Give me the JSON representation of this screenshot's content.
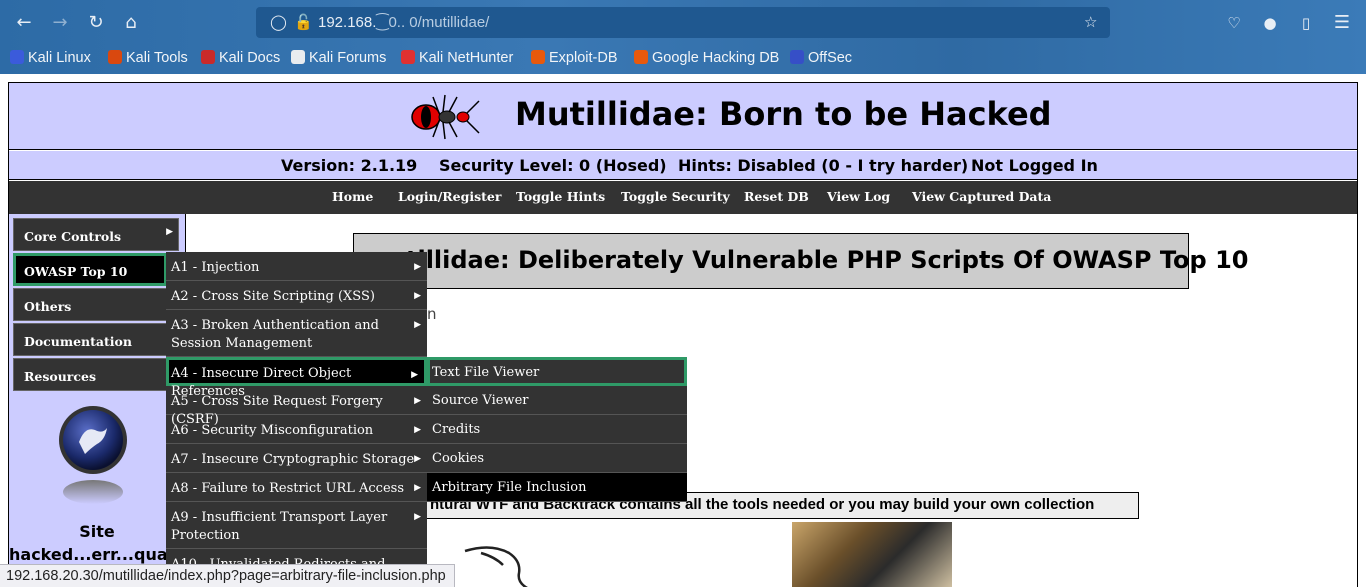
{
  "browser": {
    "url_main": "192.168.",
    "url_blur": "⁐0.. 0",
    "url_path": "/mutillidae/",
    "bookmarks": [
      {
        "label": "Kali Linux",
        "color": "#3b5bdb"
      },
      {
        "label": "Kali Tools",
        "color": "#d9480f"
      },
      {
        "label": "Kali Docs",
        "color": "#c92a2a"
      },
      {
        "label": "Kali Forums",
        "color": "#e9ecef"
      },
      {
        "label": "Kali NetHunter",
        "color": "#e03131"
      },
      {
        "label": "Exploit-DB",
        "color": "#e8590c"
      },
      {
        "label": "Google Hacking DB",
        "color": "#e8590c"
      },
      {
        "label": "OffSec",
        "color": "#364fc7"
      }
    ],
    "status_link": "192.168.20.30/mutillidae/index.php?page=arbitrary-file-inclusion.php"
  },
  "header": {
    "title": "Mutillidae: Born to be Hacked",
    "version": "Version: 2.1.19",
    "security": "Security Level: 0 (Hosed)",
    "hints": "Hints: Disabled (0 - I try harder)",
    "login": "Not Logged In"
  },
  "topnav": [
    "Home",
    "Login/Register",
    "Toggle Hints",
    "Toggle Security",
    "Reset DB",
    "View Log",
    "View Captured Data"
  ],
  "left_menu": [
    "Core Controls",
    "OWASP Top 10",
    "Others",
    "Documentation",
    "Resources"
  ],
  "left_text": {
    "line1": "Site",
    "line2": "hacked...err...qualit"
  },
  "owasp_menu": [
    "A1 - Injection",
    "A2 - Cross Site Scripting (XSS)",
    "A3 - Broken Authentication and Session Management",
    "A4 - Insecure Direct Object References",
    "A5 - Cross Site Request Forgery (CSRF)",
    "A6 - Security Misconfiguration",
    "A7 - Insecure Cryptographic Storage",
    "A8 - Failure to Restrict URL Access",
    "A9 - Insufficient Transport Layer Protection",
    "A10 - Unvalidated Redirects and"
  ],
  "a4_submenu": [
    "Text File Viewer",
    "Source Viewer",
    "Credits",
    "Cookies",
    "Arbitrary File Inclusion"
  ],
  "main": {
    "title": "Mutillidae: Deliberately Vulnerable PHP Scripts Of OWASP Top 10",
    "title_visible": "tillidae: Deliberately Vulnerable PHP Scripts Of OWASP Top 10",
    "fragment": "n",
    "tools_visible": "ntural WTF and Backtrack contains all the tools needed or you may build your own collection"
  }
}
